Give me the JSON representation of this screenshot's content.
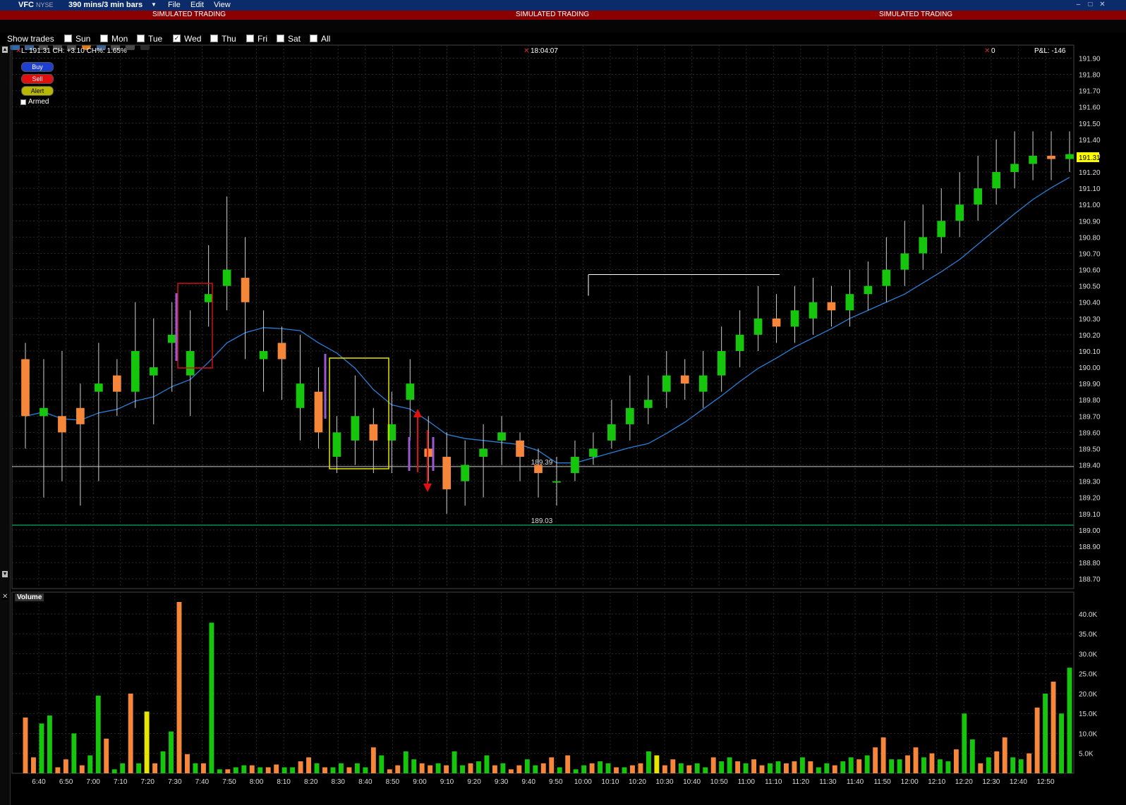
{
  "titlebar": {
    "symbol": "VFC",
    "exchange": "NYSE",
    "interval": "390 mins/3 min bars",
    "menu": [
      "File",
      "Edit",
      "View"
    ]
  },
  "simbar": {
    "label": "SIMULATED TRADING"
  },
  "days": {
    "show_trades": "Show trades",
    "items": [
      {
        "label": "Sun",
        "checked": false
      },
      {
        "label": "Mon",
        "checked": false
      },
      {
        "label": "Tue",
        "checked": false
      },
      {
        "label": "Wed",
        "checked": true
      },
      {
        "label": "Thu",
        "checked": false
      },
      {
        "label": "Fri",
        "checked": false
      },
      {
        "label": "Sat",
        "checked": false
      },
      {
        "label": "All",
        "checked": false
      }
    ]
  },
  "info": {
    "quote": "L: 191.31 CH: +3.10 CH%: 1.65%",
    "time": "18:04:07",
    "position": "0",
    "pnl": "P&L: -146"
  },
  "order_buttons": {
    "buy": "Buy",
    "sell": "Sell",
    "alert": "Alert",
    "armed": "Armed"
  },
  "volume_panel": {
    "label": "Volume"
  },
  "colors": {
    "up": "#16c60c",
    "down": "#f5863a",
    "neutral_volume": "#e6e600",
    "ma": "#2b7fd6",
    "last_price_tag": "#ffff00",
    "support_line": "#0a6b3a"
  },
  "chart_data": {
    "type": "candlestick",
    "price_axis": {
      "ticks": [
        "191.90",
        "191.80",
        "191.70",
        "191.60",
        "191.50",
        "191.40",
        "191.30",
        "191.20",
        "191.10",
        "191.00",
        "190.90",
        "190.80",
        "190.70",
        "190.60",
        "190.50",
        "190.40",
        "190.30",
        "190.20",
        "190.10",
        "190.00",
        "189.90",
        "189.80",
        "189.70",
        "189.60",
        "189.50",
        "189.40",
        "189.30",
        "189.20",
        "189.10",
        "189.00",
        "188.90",
        "188.80",
        "188.70"
      ],
      "range": [
        188.64,
        191.98
      ]
    },
    "time_axis": {
      "ticks": [
        "6:40",
        "6:50",
        "7:00",
        "7:10",
        "7:20",
        "7:30",
        "7:40",
        "7:50",
        "8:00",
        "8:10",
        "8:20",
        "8:30",
        "8:40",
        "8:50",
        "9:00",
        "9:10",
        "9:20",
        "9:30",
        "9:40",
        "9:50",
        "10:00",
        "10:10",
        "10:20",
        "10:30",
        "10:40",
        "10:50",
        "11:00",
        "11:10",
        "11:20",
        "11:30",
        "11:40",
        "11:50",
        "12:00",
        "12:10",
        "12:20",
        "12:30",
        "12:40",
        "12:50"
      ]
    },
    "last_price": "191.31",
    "horizontal_lines": [
      {
        "value": 189.39,
        "label": "189.39"
      },
      {
        "value": 189.03,
        "label": "189.03"
      },
      {
        "value": 190.57,
        "label": ""
      }
    ],
    "candles": [
      [
        190.05,
        189.7,
        190.15,
        189.5
      ],
      [
        189.7,
        189.75,
        190.05,
        189.2
      ],
      [
        189.7,
        189.6,
        190.1,
        189.3
      ],
      [
        189.75,
        189.65,
        189.9,
        189.15
      ],
      [
        189.85,
        189.9,
        190.15,
        189.3
      ],
      [
        189.95,
        189.85,
        190.05,
        189.7
      ],
      [
        189.85,
        190.1,
        190.4,
        189.75
      ],
      [
        189.95,
        190.0,
        190.3,
        189.65
      ],
      [
        190.15,
        190.2,
        190.4,
        189.85
      ],
      [
        189.95,
        190.1,
        190.35,
        189.7
      ],
      [
        190.4,
        190.45,
        190.75,
        190.25
      ],
      [
        190.5,
        190.6,
        191.05,
        190.35
      ],
      [
        190.55,
        190.4,
        190.8,
        190.05
      ],
      [
        190.05,
        190.1,
        190.35,
        189.85
      ],
      [
        190.15,
        190.05,
        190.25,
        189.8
      ],
      [
        189.75,
        189.9,
        190.2,
        189.55
      ],
      [
        189.85,
        189.6,
        190.0,
        189.5
      ],
      [
        189.45,
        189.6,
        189.7,
        189.35
      ],
      [
        189.55,
        189.7,
        189.95,
        189.4
      ],
      [
        189.65,
        189.55,
        189.75,
        189.35
      ],
      [
        189.55,
        189.65,
        189.85,
        189.35
      ],
      [
        189.8,
        189.9,
        190.05,
        189.55
      ],
      [
        189.5,
        189.45,
        189.7,
        189.3
      ],
      [
        189.45,
        189.25,
        189.6,
        189.1
      ],
      [
        189.3,
        189.4,
        189.55,
        189.15
      ],
      [
        189.45,
        189.5,
        189.65,
        189.2
      ],
      [
        189.55,
        189.6,
        189.7,
        189.4
      ],
      [
        189.55,
        189.45,
        189.6,
        189.3
      ],
      [
        189.4,
        189.35,
        189.5,
        189.2
      ],
      [
        189.3,
        189.3,
        189.45,
        189.15
      ],
      [
        189.35,
        189.45,
        189.55,
        189.3
      ],
      [
        189.45,
        189.5,
        189.6,
        189.4
      ],
      [
        189.55,
        189.65,
        189.8,
        189.5
      ],
      [
        189.65,
        189.75,
        189.95,
        189.55
      ],
      [
        189.75,
        189.8,
        189.95,
        189.65
      ],
      [
        189.85,
        189.95,
        190.1,
        189.75
      ],
      [
        189.95,
        189.9,
        190.05,
        189.8
      ],
      [
        189.85,
        189.95,
        190.1,
        189.75
      ],
      [
        189.95,
        190.1,
        190.25,
        189.85
      ],
      [
        190.1,
        190.2,
        190.35,
        190.0
      ],
      [
        190.2,
        190.3,
        190.5,
        190.1
      ],
      [
        190.3,
        190.25,
        190.45,
        190.15
      ],
      [
        190.25,
        190.35,
        190.5,
        190.15
      ],
      [
        190.3,
        190.4,
        190.55,
        190.2
      ],
      [
        190.4,
        190.35,
        190.5,
        190.25
      ],
      [
        190.35,
        190.45,
        190.6,
        190.25
      ],
      [
        190.45,
        190.5,
        190.65,
        190.35
      ],
      [
        190.5,
        190.6,
        190.8,
        190.4
      ],
      [
        190.6,
        190.7,
        190.9,
        190.5
      ],
      [
        190.7,
        190.8,
        191.0,
        190.6
      ],
      [
        190.8,
        190.9,
        191.1,
        190.7
      ],
      [
        190.9,
        191.0,
        191.2,
        190.8
      ],
      [
        191.0,
        191.1,
        191.3,
        190.9
      ],
      [
        191.1,
        191.2,
        191.4,
        191.0
      ],
      [
        191.2,
        191.25,
        191.45,
        191.1
      ],
      [
        191.25,
        191.3,
        191.45,
        191.15
      ],
      [
        191.3,
        191.28,
        191.45,
        191.15
      ],
      [
        191.28,
        191.31,
        191.45,
        191.2
      ]
    ],
    "volume_axis": {
      "ticks": [
        "40.0K",
        "35.0K",
        "30.0K",
        "25.0K",
        "20.0K",
        "15.0K",
        "10.0K",
        "5.0K"
      ],
      "range": [
        0,
        43000
      ]
    },
    "volumes": [
      14000,
      4000,
      12500,
      14500,
      1500,
      3500,
      10000,
      2000,
      4500,
      19500,
      8700,
      1000,
      2500,
      20000,
      2500,
      15500,
      2500,
      5500,
      10500,
      43000,
      4800,
      2500,
      2500,
      37800,
      1000,
      1000,
      1500,
      2000,
      2000,
      1500,
      1500,
      2200,
      1500,
      1500,
      3000,
      4000,
      2500,
      1500,
      1500,
      2500,
      1500,
      2500,
      1500,
      6500,
      4500,
      1000,
      2000,
      5500,
      3500,
      2500,
      2000,
      2500,
      2000,
      5500,
      2000,
      2500,
      3000,
      4500,
      2000,
      2500,
      1000,
      2000,
      3500,
      2000,
      2500,
      4000,
      1500,
      4500,
      1000,
      2000,
      2500,
      3000,
      2500,
      1500,
      1500,
      2000,
      2500,
      5500,
      4500,
      2000,
      3500,
      2500,
      2000,
      2500,
      1500,
      4000,
      3000,
      4000,
      3000,
      2500,
      3500,
      2000,
      2500,
      3000,
      2500,
      3000,
      4000,
      3000,
      1500,
      2500,
      2000,
      3000,
      4000,
      3500,
      4500,
      6500,
      9000,
      3500,
      3500,
      4500,
      6500,
      4000,
      5000,
      3500,
      3000,
      6000,
      15000,
      8500,
      2500,
      4000,
      5500,
      9000,
      4000,
      3500,
      5000,
      16500,
      20000,
      23000,
      15000,
      26500
    ]
  }
}
